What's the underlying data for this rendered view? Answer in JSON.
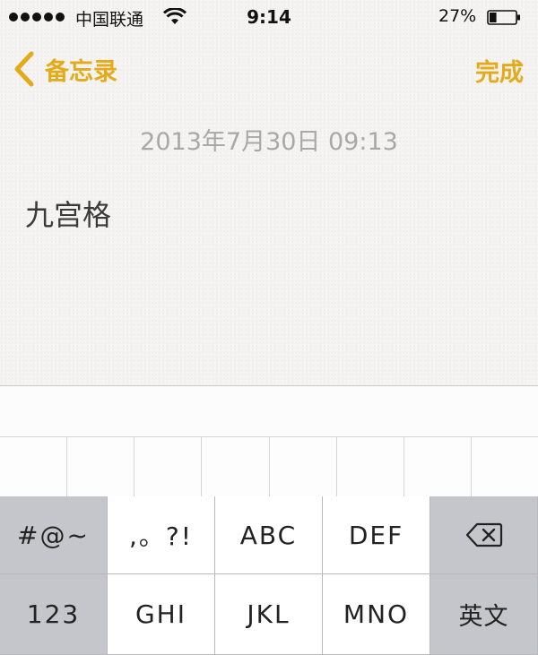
{
  "status_bar": {
    "carrier": "中国联通",
    "time": "9:14",
    "battery_percent": "27%",
    "battery_level": 0.27,
    "signal_bars": 5
  },
  "nav": {
    "back_label": "备忘录",
    "done_label": "完成"
  },
  "note": {
    "date": "2013年7月30日  09:13",
    "body": "九宫格"
  },
  "keyboard": {
    "row1": [
      "#@~",
      ",。?!",
      "ABC",
      "DEF",
      "delete-icon"
    ],
    "row2": [
      "123",
      "GHI",
      "JKL",
      "MNO",
      "英文"
    ]
  },
  "colors": {
    "accent": "#e4aa1a",
    "date_text": "#a8a8a8",
    "dark_key": "#c5c6cb",
    "light_key": "#ffffff"
  }
}
